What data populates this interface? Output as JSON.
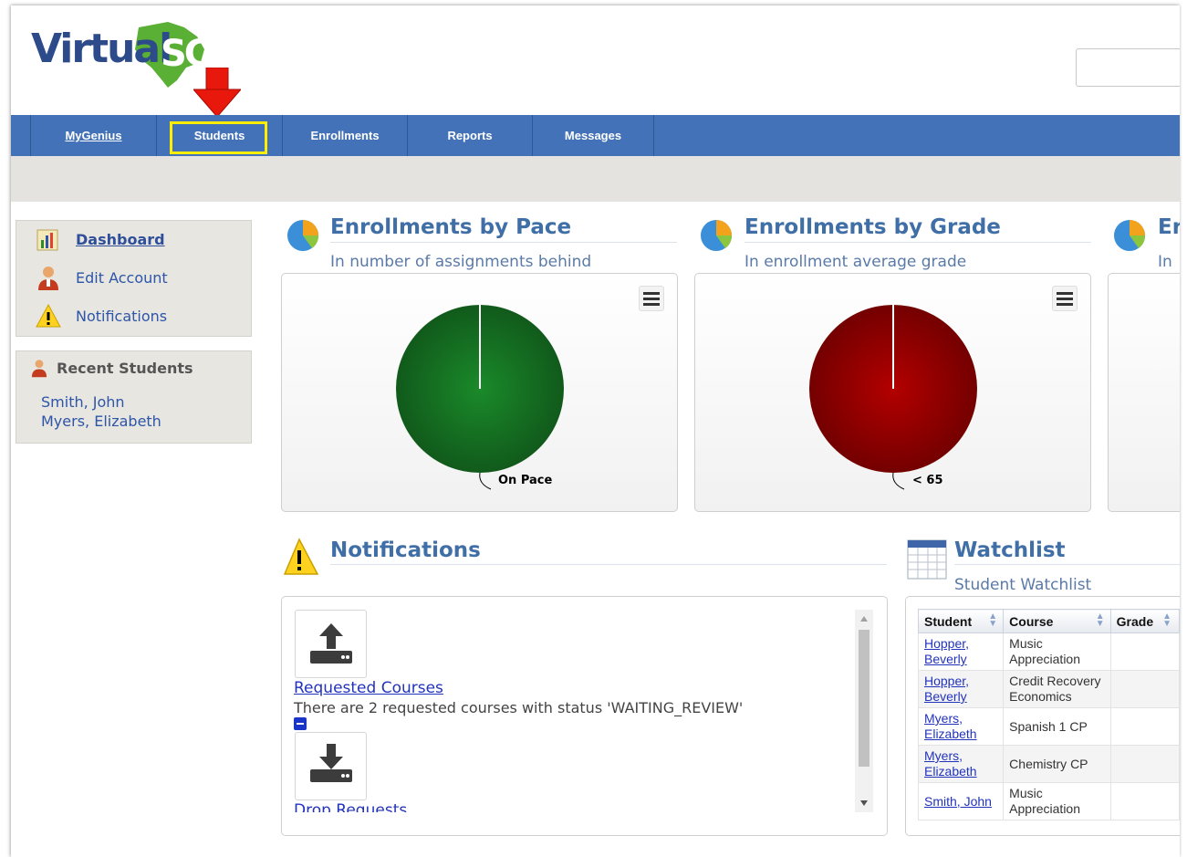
{
  "app": {
    "logo_text": "VirtualSC"
  },
  "nav": {
    "items": [
      "MyGenius",
      "Students",
      "Enrollments",
      "Reports",
      "Messages"
    ]
  },
  "sidebar": {
    "menu": [
      {
        "label": "Dashboard",
        "icon": "chart-book-icon"
      },
      {
        "label": "Edit Account",
        "icon": "user-icon"
      },
      {
        "label": "Notifications",
        "icon": "warning-icon"
      }
    ],
    "recent_title": "Recent Students",
    "recent": [
      "Smith, John",
      "Myers, Elizabeth"
    ]
  },
  "widgets": {
    "pace": {
      "title": "Enrollments by Pace",
      "subtitle": "In number of assignments behind",
      "icon": "pie-chart-icon"
    },
    "grade": {
      "title": "Enrollments by Grade",
      "subtitle": "In enrollment average grade",
      "icon": "pie-chart-icon"
    },
    "third": {
      "title_fragment": "Er",
      "subtitle_fragment": "In"
    }
  },
  "chart_data": [
    {
      "type": "pie",
      "title": "Enrollments by Pace",
      "subtitle": "In number of assignments behind",
      "categories": [
        "On Pace"
      ],
      "values": [
        100
      ],
      "colors": [
        "#1a8a2a"
      ]
    },
    {
      "type": "pie",
      "title": "Enrollments by Grade",
      "subtitle": "In enrollment average grade",
      "categories": [
        "< 65"
      ],
      "values": [
        100
      ],
      "colors": [
        "#b30000"
      ]
    }
  ],
  "notifications": {
    "title": "Notifications",
    "items": [
      {
        "icon": "upload-icon",
        "link": "Requested Courses",
        "text": "There are 2 requested courses with status 'WAITING_REVIEW'"
      },
      {
        "icon": "download-icon",
        "link": "Drop Requests",
        "text": ""
      }
    ]
  },
  "watchlist": {
    "title": "Watchlist",
    "subtitle": "Student Watchlist",
    "columns": [
      "Student",
      "Course",
      "Grade"
    ],
    "rows": [
      {
        "student": "Hopper, Beverly",
        "course": "Music Appreciation",
        "grade": ""
      },
      {
        "student": "Hopper, Beverly",
        "course": "Credit Recovery Economics",
        "grade": ""
      },
      {
        "student": "Myers, Elizabeth",
        "course": "Spanish 1 CP",
        "grade": ""
      },
      {
        "student": "Myers, Elizabeth",
        "course": "Chemistry CP",
        "grade": ""
      },
      {
        "student": "Smith, John",
        "course": "Music Appreciation",
        "grade": ""
      }
    ]
  },
  "colors": {
    "nav_bg": "#4472b8",
    "highlight": "#ffee00",
    "arrow": "#e8180c",
    "title_blue": "#3f6fa6"
  }
}
